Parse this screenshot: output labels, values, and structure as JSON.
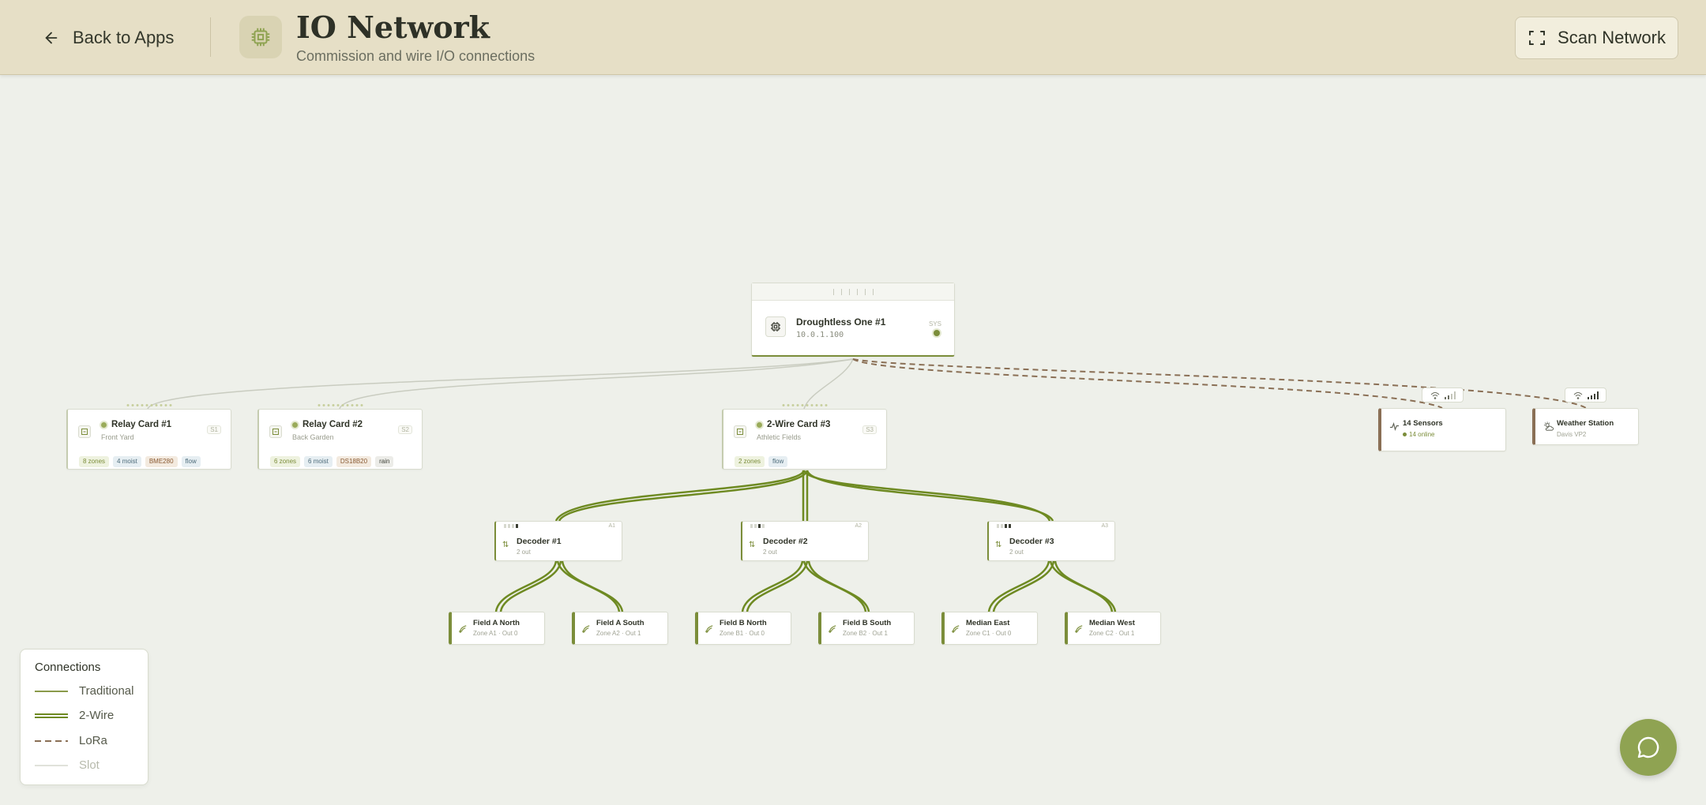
{
  "header": {
    "back_label": "Back to Apps",
    "title": "IO Network",
    "subtitle": "Commission and wire I/O connections",
    "scan_label": "Scan Network"
  },
  "controller": {
    "name": "Droughtless One #1",
    "ip": "10.0.1.100",
    "sys": "SYS"
  },
  "cards": [
    {
      "name": "Relay Card #1",
      "location": "Front Yard",
      "slot": "S1",
      "tags": [
        "8 zones",
        "4 moist",
        "BME280",
        "flow"
      ]
    },
    {
      "name": "Relay Card #2",
      "location": "Back Garden",
      "slot": "S2",
      "tags": [
        "6 zones",
        "6 moist",
        "DS18B20",
        "rain"
      ]
    },
    {
      "name": "2-Wire Card #3",
      "location": "Athletic Fields",
      "slot": "S3",
      "tags": [
        "2 zones",
        "flow"
      ]
    }
  ],
  "decoders": [
    {
      "name": "Decoder #1",
      "outputs": "2 out",
      "addr": "A1"
    },
    {
      "name": "Decoder #2",
      "outputs": "2 out",
      "addr": "A2"
    },
    {
      "name": "Decoder #3",
      "outputs": "2 out",
      "addr": "A3"
    }
  ],
  "zones": [
    {
      "name": "Field A North",
      "detail": "Zone A1 · Out 0"
    },
    {
      "name": "Field A South",
      "detail": "Zone A2 · Out 1"
    },
    {
      "name": "Field B North",
      "detail": "Zone B1 · Out 0"
    },
    {
      "name": "Field B South",
      "detail": "Zone B2 · Out 1"
    },
    {
      "name": "Median East",
      "detail": "Zone C1 · Out 0"
    },
    {
      "name": "Median West",
      "detail": "Zone C2 · Out 1"
    }
  ],
  "lora_devices": [
    {
      "name": "14 Sensors",
      "detail": "14 online",
      "icon": "activity-icon"
    },
    {
      "name": "Weather Station",
      "detail": "Davis VP2",
      "icon": "weather-icon"
    }
  ],
  "legend": {
    "title": "Connections",
    "items": [
      {
        "label": "Traditional",
        "style": "single"
      },
      {
        "label": "2-Wire",
        "style": "double"
      },
      {
        "label": "LoRa",
        "style": "dashed"
      },
      {
        "label": "Slot",
        "style": "faint"
      }
    ]
  },
  "colors": {
    "accent": "#7b8d3a",
    "lora": "#8a6f55",
    "header_bg": "#e6dfc6",
    "canvas_bg": "#eef0ea",
    "fab": "#8fa352"
  }
}
